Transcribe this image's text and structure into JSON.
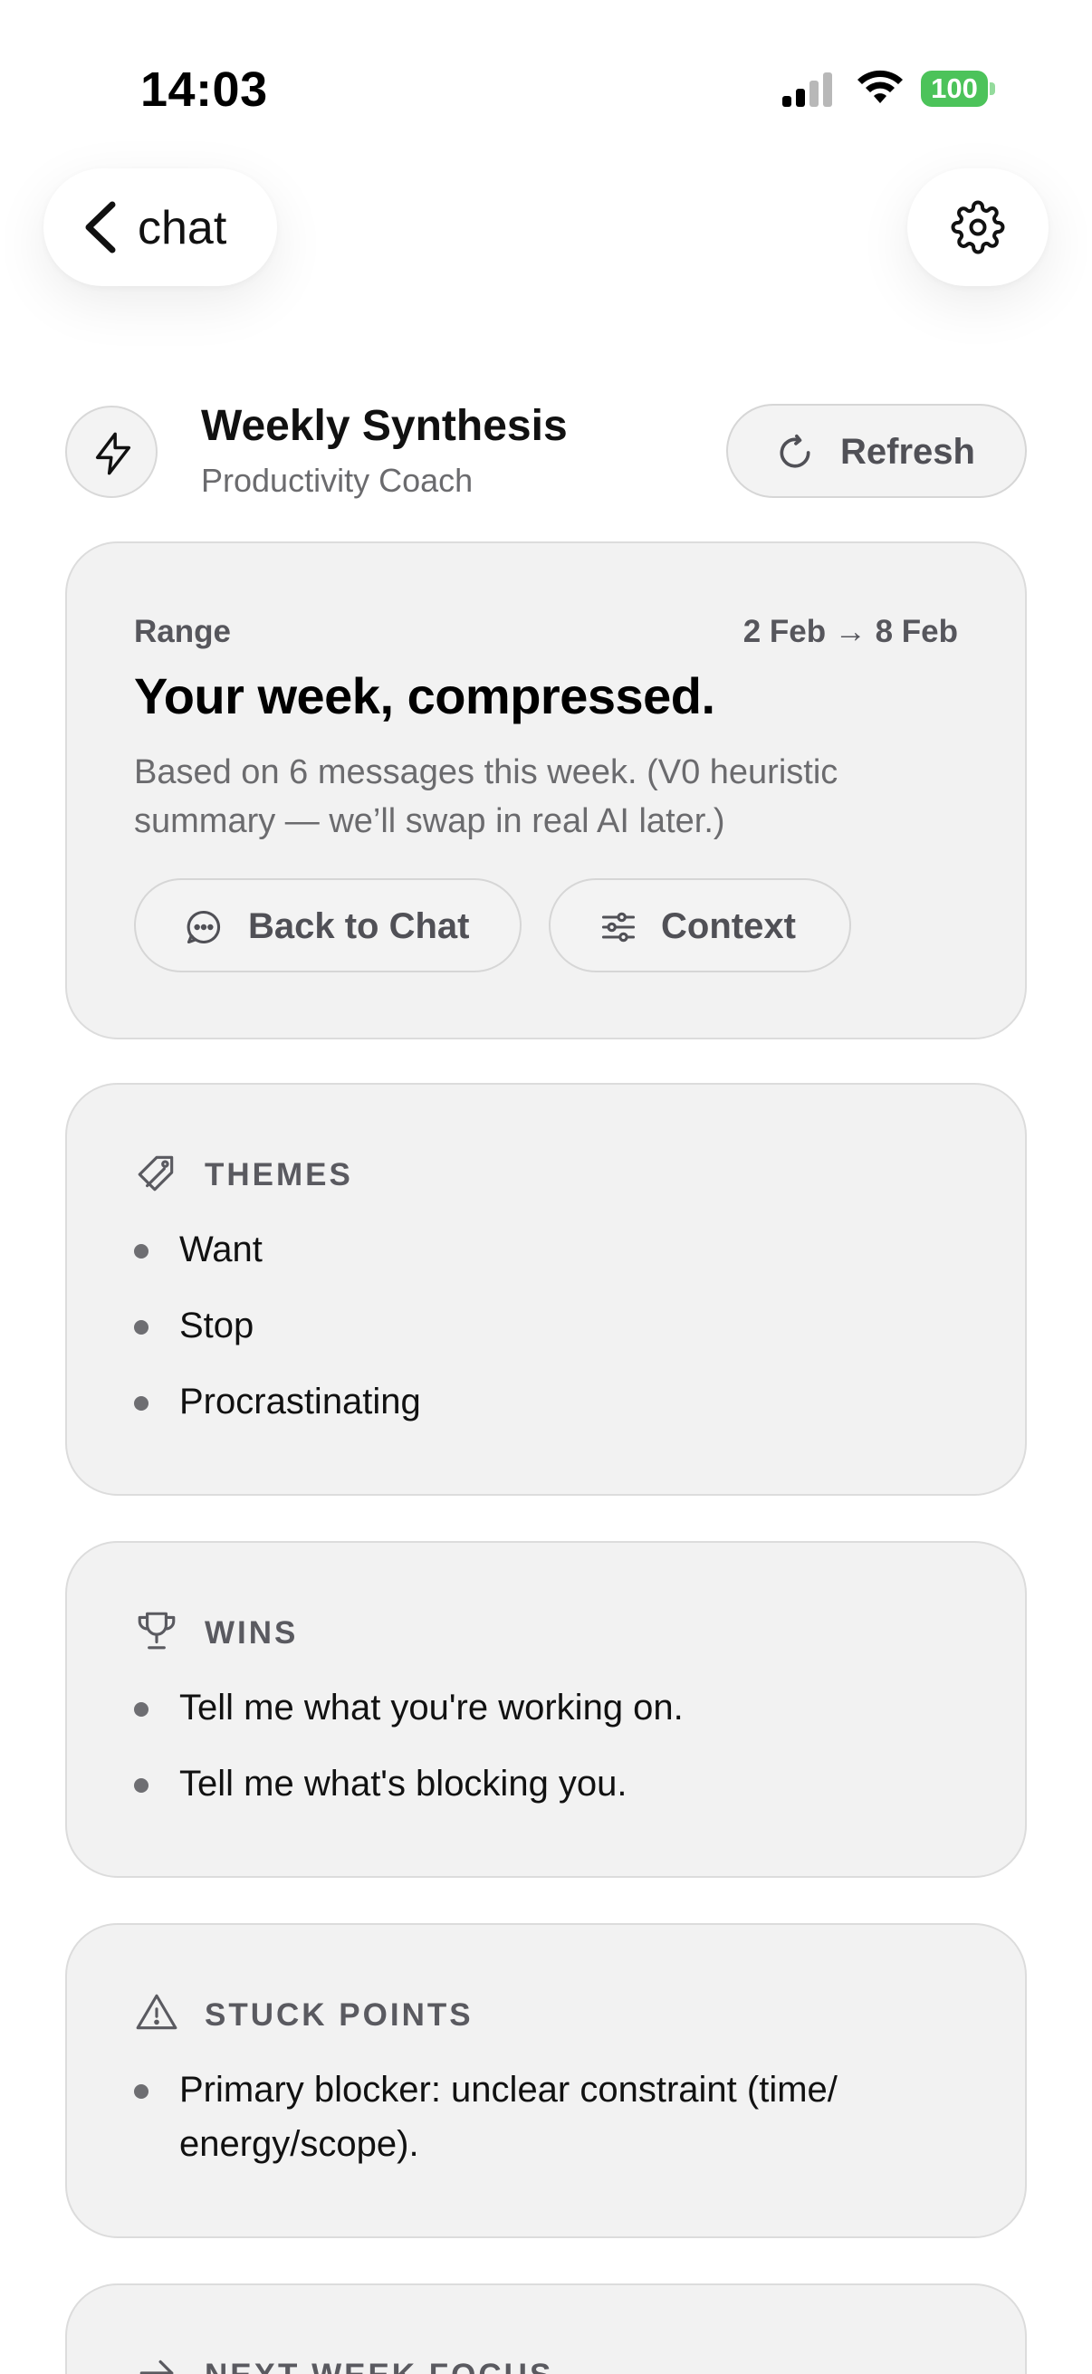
{
  "status_bar": {
    "time": "14:03",
    "battery": "100",
    "signal_icon": "cellular-signal-icon",
    "wifi_icon": "wifi-icon",
    "battery_color": "#4cc35a"
  },
  "nav": {
    "back_label": "chat",
    "back_icon": "chevron-left-icon",
    "settings_icon": "gear-icon"
  },
  "header": {
    "icon": "bolt-icon",
    "title": "Weekly Synthesis",
    "subtitle": "Productivity Coach",
    "refresh_label": "Refresh",
    "refresh_icon": "refresh-icon"
  },
  "range_card": {
    "label": "Range",
    "value": "2 Feb → 8 Feb",
    "title": "Your week, compressed.",
    "description": "Based on 6 messages this week. (V0 heuristic summary — we’ll swap in real AI later.)",
    "back_to_chat_label": "Back to Chat",
    "context_label": "Context"
  },
  "sections": {
    "themes": {
      "icon": "tag-icon",
      "title": "THEMES",
      "items": [
        "Want",
        "Stop",
        "Procrastinating"
      ]
    },
    "wins": {
      "icon": "trophy-icon",
      "title": "WINS",
      "items": [
        "Tell me what you're working on.",
        "Tell me what's blocking you."
      ]
    },
    "stuck": {
      "icon": "warning-icon",
      "title": "STUCK POINTS",
      "items": [
        "Primary blocker: unclear constraint (time/ energy/scope)."
      ]
    },
    "next": {
      "icon": "arrow-right-icon",
      "title": "NEXT WEEK FOCUS"
    }
  },
  "colors": {
    "card_background": "#f2f2f2",
    "muted_text": "#6b6b6e",
    "accent_text": "#505056"
  }
}
